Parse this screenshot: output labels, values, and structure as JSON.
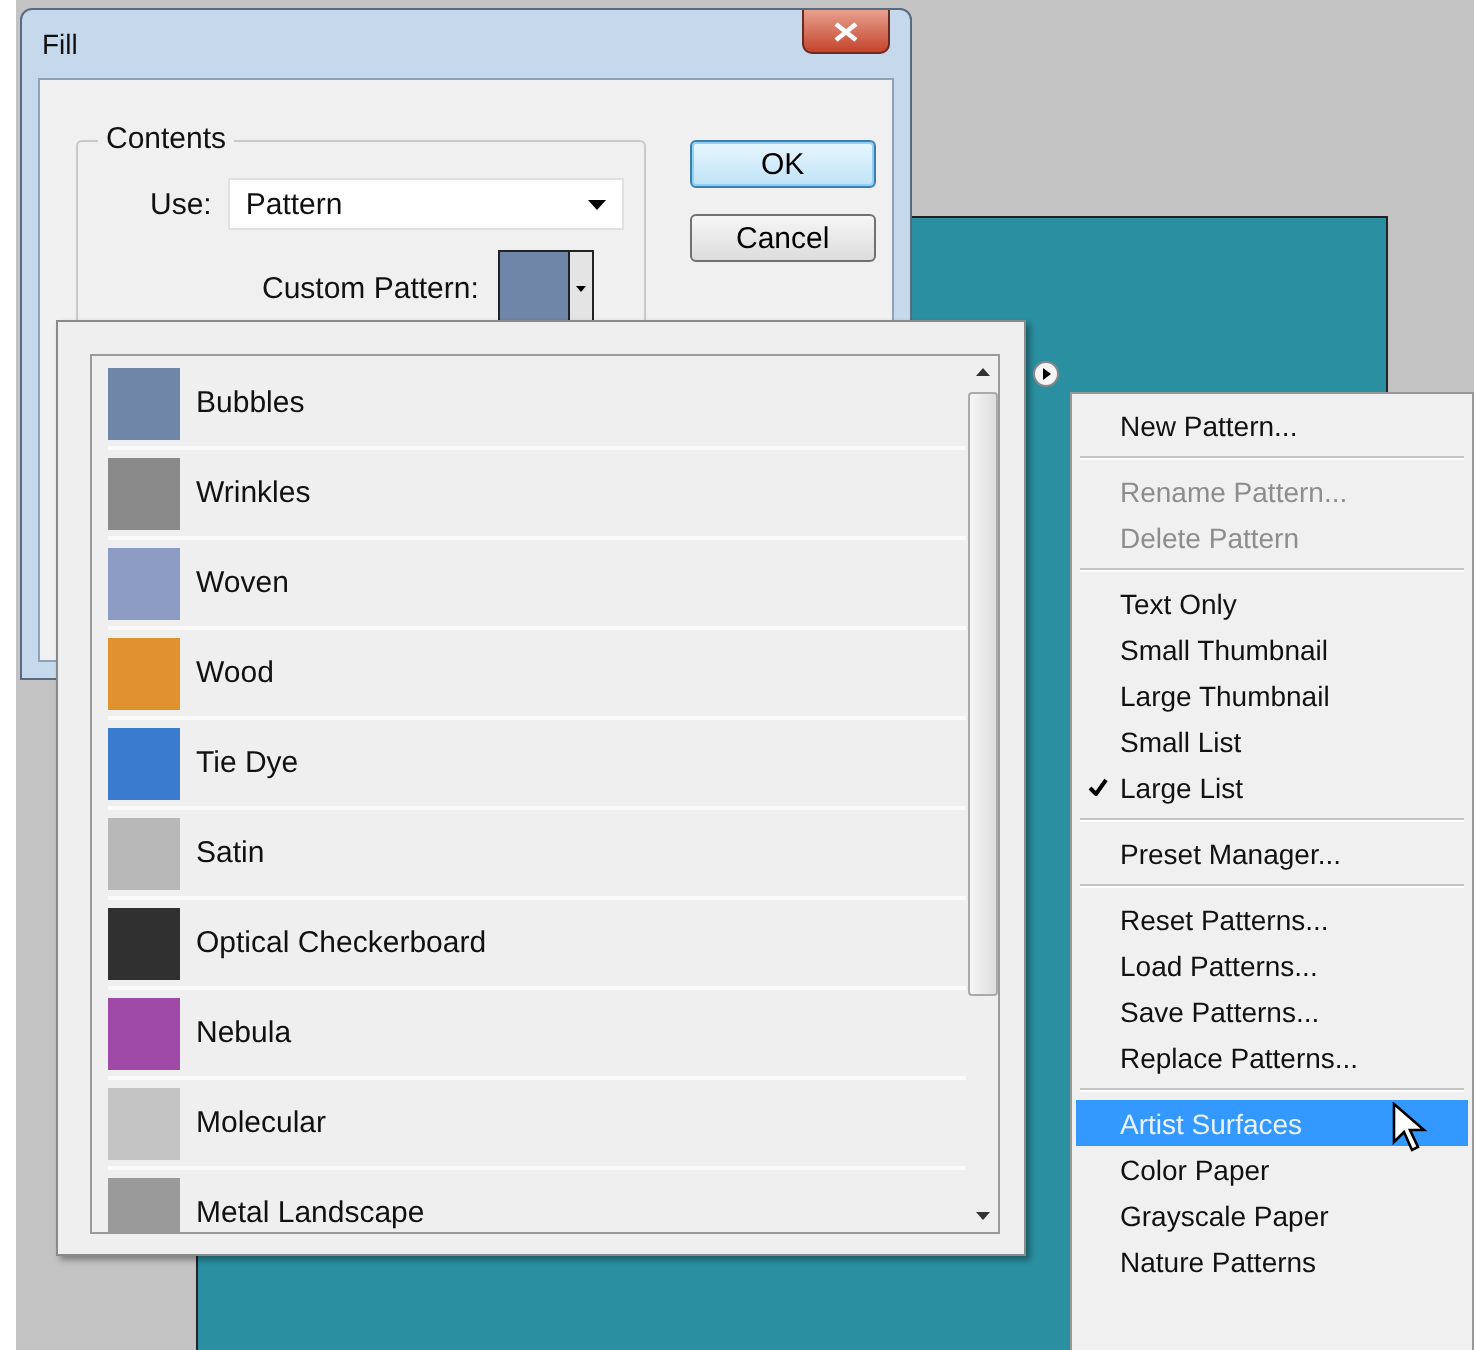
{
  "window": {
    "title": "Fill"
  },
  "contents": {
    "legend": "Contents",
    "use_label": "Use:",
    "use_value": "Pattern",
    "custom_pattern_label": "Custom Pattern:"
  },
  "buttons": [
    {
      "label": "OK",
      "default": true
    },
    {
      "label": "Cancel",
      "default": false
    }
  ],
  "patterns": [
    {
      "name": "Bubbles",
      "color": "#6f86a8"
    },
    {
      "name": "Wrinkles",
      "color": "#8a8a8a"
    },
    {
      "name": "Woven",
      "color": "#8d9cc4"
    },
    {
      "name": "Wood",
      "color": "#e0922f"
    },
    {
      "name": "Tie Dye",
      "color": "#3a7bd0"
    },
    {
      "name": "Satin",
      "color": "#b8b8b8"
    },
    {
      "name": "Optical Checkerboard",
      "color": "#303030"
    },
    {
      "name": "Nebula",
      "color": "#a04aa8"
    },
    {
      "name": "Molecular",
      "color": "#c4c4c4"
    },
    {
      "name": "Metal Landscape",
      "color": "#9a9a9a"
    }
  ],
  "flyout_menu": {
    "groups": [
      [
        {
          "label": "New Pattern...",
          "disabled": false,
          "checked": false,
          "selected": false
        }
      ],
      [
        {
          "label": "Rename Pattern...",
          "disabled": true,
          "checked": false,
          "selected": false
        },
        {
          "label": "Delete Pattern",
          "disabled": true,
          "checked": false,
          "selected": false
        }
      ],
      [
        {
          "label": "Text Only",
          "disabled": false,
          "checked": false,
          "selected": false
        },
        {
          "label": "Small Thumbnail",
          "disabled": false,
          "checked": false,
          "selected": false
        },
        {
          "label": "Large Thumbnail",
          "disabled": false,
          "checked": false,
          "selected": false
        },
        {
          "label": "Small List",
          "disabled": false,
          "checked": false,
          "selected": false
        },
        {
          "label": "Large List",
          "disabled": false,
          "checked": true,
          "selected": false
        }
      ],
      [
        {
          "label": "Preset Manager...",
          "disabled": false,
          "checked": false,
          "selected": false
        }
      ],
      [
        {
          "label": "Reset Patterns...",
          "disabled": false,
          "checked": false,
          "selected": false
        },
        {
          "label": "Load Patterns...",
          "disabled": false,
          "checked": false,
          "selected": false
        },
        {
          "label": "Save Patterns...",
          "disabled": false,
          "checked": false,
          "selected": false
        },
        {
          "label": "Replace Patterns...",
          "disabled": false,
          "checked": false,
          "selected": false
        }
      ],
      [
        {
          "label": "Artist Surfaces",
          "disabled": false,
          "checked": false,
          "selected": true
        },
        {
          "label": "Color Paper",
          "disabled": false,
          "checked": false,
          "selected": false
        },
        {
          "label": "Grayscale Paper",
          "disabled": false,
          "checked": false,
          "selected": false
        },
        {
          "label": "Nature Patterns",
          "disabled": false,
          "checked": false,
          "selected": false
        }
      ]
    ]
  }
}
